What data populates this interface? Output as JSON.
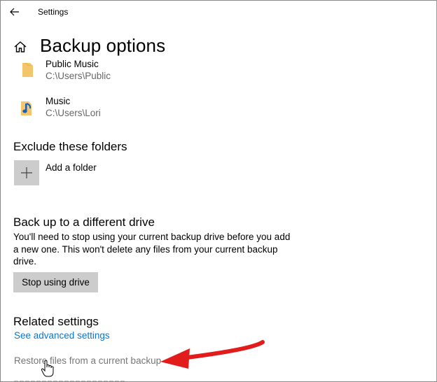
{
  "window": {
    "title": "Settings"
  },
  "page": {
    "title": "Backup options"
  },
  "folders": [
    {
      "name": "Public Music",
      "path": "C:\\Users\\Public"
    },
    {
      "name": "Music",
      "path": "C:\\Users\\Lori"
    }
  ],
  "exclude": {
    "heading": "Exclude these folders",
    "add_label": "Add a folder"
  },
  "different_drive": {
    "heading": "Back up to a different drive",
    "description": "You'll need to stop using your current backup drive before you add a new one. This won't delete any files from your current backup drive.",
    "button_label": "Stop using drive"
  },
  "related": {
    "heading": "Related settings",
    "links": [
      "See advanced settings",
      "Restore files from a current backup"
    ]
  },
  "colors": {
    "accent": "#0078d7",
    "folder": "#f4c66b",
    "annotation": "#e21b1b"
  },
  "icons": {
    "back": "back-arrow-icon",
    "home": "home-icon",
    "folder": "folder-icon",
    "music_folder": "music-folder-icon",
    "plus": "plus-icon",
    "cursor": "hand-cursor-icon",
    "annotation": "red-arrow-annotation"
  }
}
